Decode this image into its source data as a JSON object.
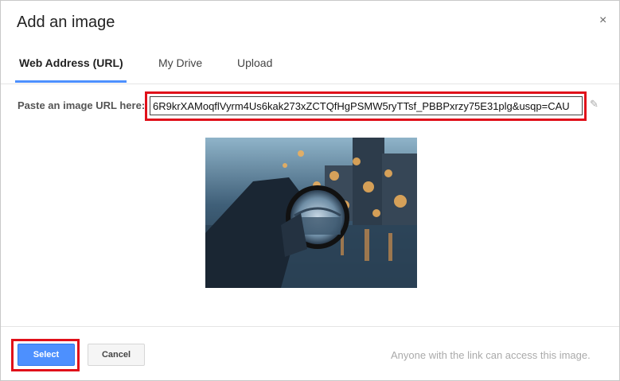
{
  "dialog": {
    "title": "Add an image",
    "close_glyph": "×"
  },
  "tabs": [
    {
      "label": "Web Address (URL)",
      "active": true
    },
    {
      "label": "My Drive",
      "active": false
    },
    {
      "label": "Upload",
      "active": false
    }
  ],
  "url_field": {
    "label": "Paste an image URL here:",
    "value": "6R9krXAMoqflVyrm4Us6kak273xZCTQfHgPSMW5ryTTsf_PBBPxrzy75E31plg&usqp=CAU"
  },
  "icons": {
    "edit": "pencil-icon",
    "close": "close-icon"
  },
  "footer": {
    "select_label": "Select",
    "cancel_label": "Cancel",
    "note": "Anyone with the link can access this image."
  },
  "colors": {
    "accent": "#4d90fe",
    "highlight": "#e0101a"
  }
}
